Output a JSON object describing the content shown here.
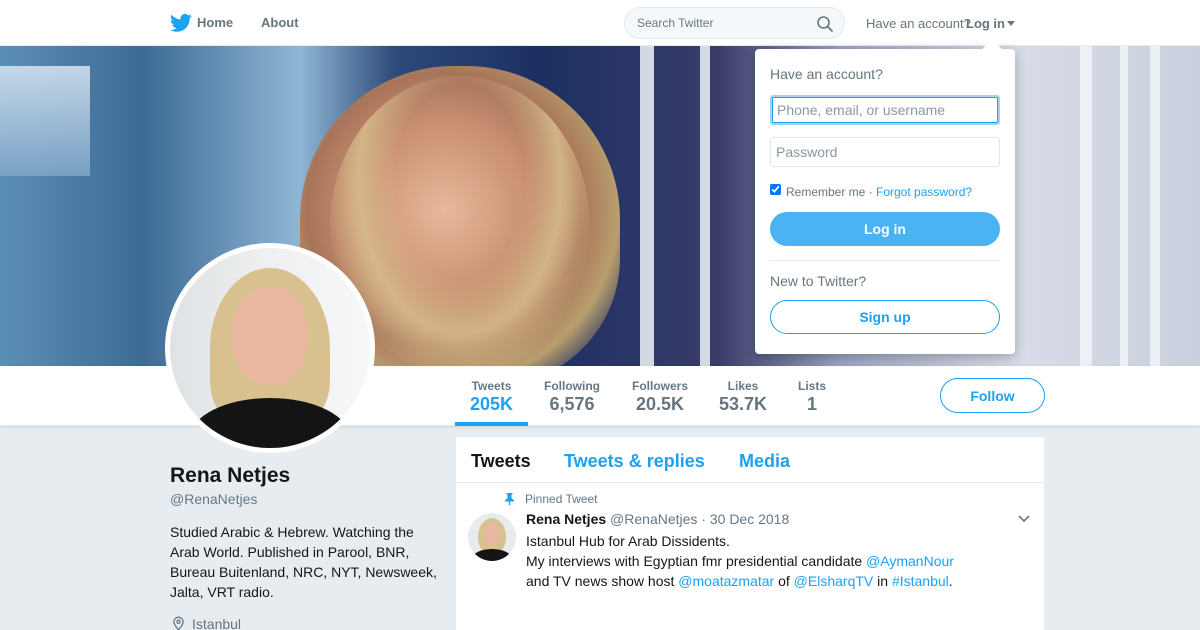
{
  "topnav": {
    "home_label": "Home",
    "about_label": "About",
    "search_placeholder": "Search Twitter",
    "have_account": "Have an account?",
    "login_label": "Log in"
  },
  "profile": {
    "name": "Rena Netjes",
    "handle": "@RenaNetjes",
    "bio": "Studied Arabic & Hebrew. Watching the Arab World. Published in Parool, BNR, Bureau Buitenland, NRC, NYT, Newsweek, Jalta, VRT radio.",
    "location": "Istanbul"
  },
  "stats": [
    {
      "label": "Tweets",
      "value": "205K"
    },
    {
      "label": "Following",
      "value": "6,576"
    },
    {
      "label": "Followers",
      "value": "20.5K"
    },
    {
      "label": "Likes",
      "value": "53.7K"
    },
    {
      "label": "Lists",
      "value": "1"
    }
  ],
  "follow_label": "Follow",
  "timeline": {
    "tabs": [
      "Tweets",
      "Tweets & replies",
      "Media"
    ],
    "pinned_label": "Pinned Tweet",
    "tweet": {
      "name": "Rena Netjes",
      "handle": "@RenaNetjes",
      "date": "· 30 Dec 2018",
      "line1": "Istanbul Hub for Arab Dissidents.",
      "line2_pre": "My interviews with Egyptian fmr presidential candidate ",
      "mention1": "@AymanNour",
      "line3_pre": "and TV news show host ",
      "mention2": "@moatazmatar",
      "of_text": " of ",
      "mention3": "@ElsharqTV",
      "in_text": " in ",
      "hashtag": "#Istanbul",
      "end": "."
    }
  },
  "login_dropdown": {
    "title": "Have an account?",
    "username_placeholder": "Phone, email, or username",
    "password_placeholder": "Password",
    "remember_label": "Remember me ·",
    "forgot_label": "Forgot password?",
    "login_button": "Log in",
    "new_label": "New to Twitter?",
    "signup_button": "Sign up"
  },
  "colors": {
    "accent": "#1da1f2",
    "login_button": "#4ab3f4",
    "background": "#e6ecf0"
  },
  "icons": [
    "twitter-bird-icon",
    "search-icon",
    "pin-icon",
    "location-pin-icon",
    "chevron-down-icon"
  ]
}
